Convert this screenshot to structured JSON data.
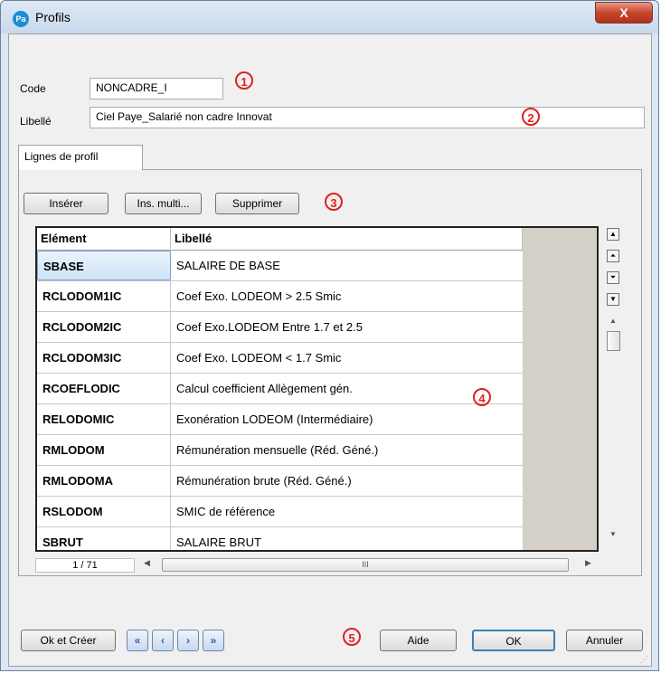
{
  "window": {
    "title": "Profils",
    "app_icon": "Pa",
    "close": "X"
  },
  "form": {
    "code_label": "Code",
    "code_value": "NONCADRE_I",
    "libelle_label": "Libellé",
    "libelle_value": "Ciel Paye_Salarié non cadre Innovat"
  },
  "tabs": [
    {
      "label": "Lignes de profil"
    }
  ],
  "toolbar": {
    "insert": "Insérer",
    "insert_multi": "Ins. multi...",
    "delete": "Supprimer"
  },
  "grid": {
    "columns": [
      "Elément",
      "Libellé"
    ],
    "rows": [
      {
        "element": "SBASE",
        "libelle": "SALAIRE DE BASE"
      },
      {
        "element": "RCLODOM1IC",
        "libelle": "Coef Exo. LODEOM > 2.5 Smic"
      },
      {
        "element": "RCLODOM2IC",
        "libelle": "Coef Exo.LODEOM Entre 1.7 et 2.5"
      },
      {
        "element": "RCLODOM3IC",
        "libelle": "Coef Exo. LODEOM < 1.7 Smic"
      },
      {
        "element": "RCOEFLODIC",
        "libelle": "Calcul coefficient Allègement gén."
      },
      {
        "element": "RELODOMIC",
        "libelle": "Exonération LODEOM (Intermédiaire)"
      },
      {
        "element": "RMLODOM",
        "libelle": "Rémunération mensuelle (Réd. Géné.)"
      },
      {
        "element": "RMLODOMA",
        "libelle": "Rémunération brute (Réd. Géné.)"
      },
      {
        "element": "RSLODOM",
        "libelle": "SMIC de référence"
      },
      {
        "element": "SBRUT",
        "libelle": "SALAIRE BRUT"
      }
    ],
    "counter": "1 / 71",
    "hscroll_mid": "III"
  },
  "annotations": [
    "1",
    "2",
    "3",
    "4",
    "5"
  ],
  "footer": {
    "ok_create": "Ok et Créer",
    "help": "Aide",
    "ok": "OK",
    "cancel": "Annuler"
  },
  "icons": [
    "app-logo-icon",
    "close-icon",
    "scroll-first-icon",
    "scroll-pageup-icon",
    "scroll-pagedown-icon",
    "scroll-last-icon",
    "nav-first-icon",
    "nav-prev-icon",
    "nav-next-icon",
    "nav-last-icon"
  ]
}
